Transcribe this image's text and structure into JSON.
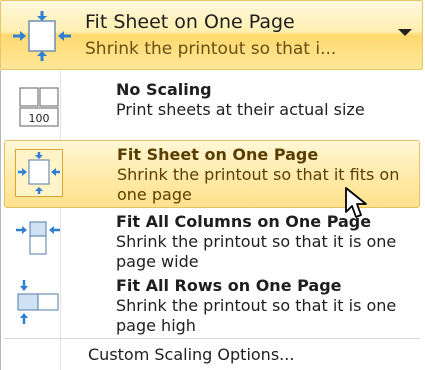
{
  "dropdown": {
    "title": "Fit Sheet on One Page",
    "subtitle": "Shrink the printout so that i...",
    "icon": "fit-sheet-icon",
    "arrow_icon": "chevron-down-icon"
  },
  "menu": {
    "items": [
      {
        "label": "No Scaling",
        "description": "Print sheets at their actual size",
        "icon": "no-scaling-icon",
        "icon_text": "100"
      },
      {
        "label": "Fit Sheet on One Page",
        "description": "Shrink the printout so that it fits on one page",
        "icon": "fit-sheet-icon",
        "highlighted": true
      },
      {
        "label": "Fit All Columns on One Page",
        "description": "Shrink the printout so that it is one page wide",
        "icon": "fit-columns-icon"
      },
      {
        "label": "Fit All Rows on One Page",
        "description": "Shrink the printout so that it is one page high",
        "icon": "fit-rows-icon"
      }
    ],
    "custom_option": "Custom Scaling Options..."
  },
  "colors": {
    "highlight_top": "#fff7d6",
    "highlight_bottom": "#ffe28e",
    "highlight_border": "#e5c365",
    "arrow_blue": "#2f7fd6"
  }
}
